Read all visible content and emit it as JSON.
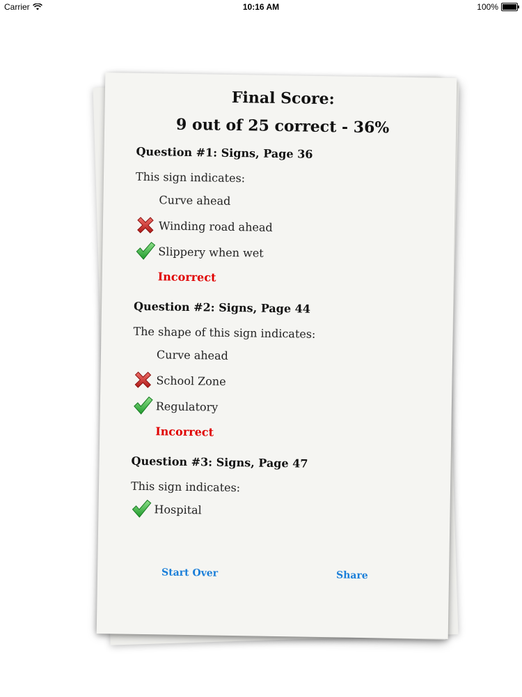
{
  "status_bar": {
    "carrier": "Carrier",
    "time": "10:16 AM",
    "battery": "100%"
  },
  "result": {
    "title": "Final Score:",
    "score": "9 out of 25 correct - 36%"
  },
  "questions": [
    {
      "heading": "Question #1: Signs, Page 36",
      "prompt": "This sign indicates:",
      "answers": [
        {
          "text": "Curve ahead",
          "mark": "none"
        },
        {
          "text": "Winding road ahead",
          "mark": "wrong"
        },
        {
          "text": "Slippery when wet",
          "mark": "correct"
        }
      ],
      "result": "Incorrect"
    },
    {
      "heading": "Question #2: Signs, Page 44",
      "prompt": "The shape of this sign indicates:",
      "answers": [
        {
          "text": "Curve ahead",
          "mark": "none"
        },
        {
          "text": "School Zone",
          "mark": "wrong"
        },
        {
          "text": "Regulatory",
          "mark": "correct"
        }
      ],
      "result": "Incorrect"
    },
    {
      "heading": "Question #3: Signs, Page 47",
      "prompt": "This sign indicates:",
      "answers": [
        {
          "text": "Hospital",
          "mark": "correct"
        }
      ]
    }
  ],
  "buttons": {
    "start_over": "Start Over",
    "share": "Share"
  },
  "colors": {
    "incorrect": "#e00000",
    "link": "#1b7fd9",
    "paper": "#f5f5f2"
  }
}
